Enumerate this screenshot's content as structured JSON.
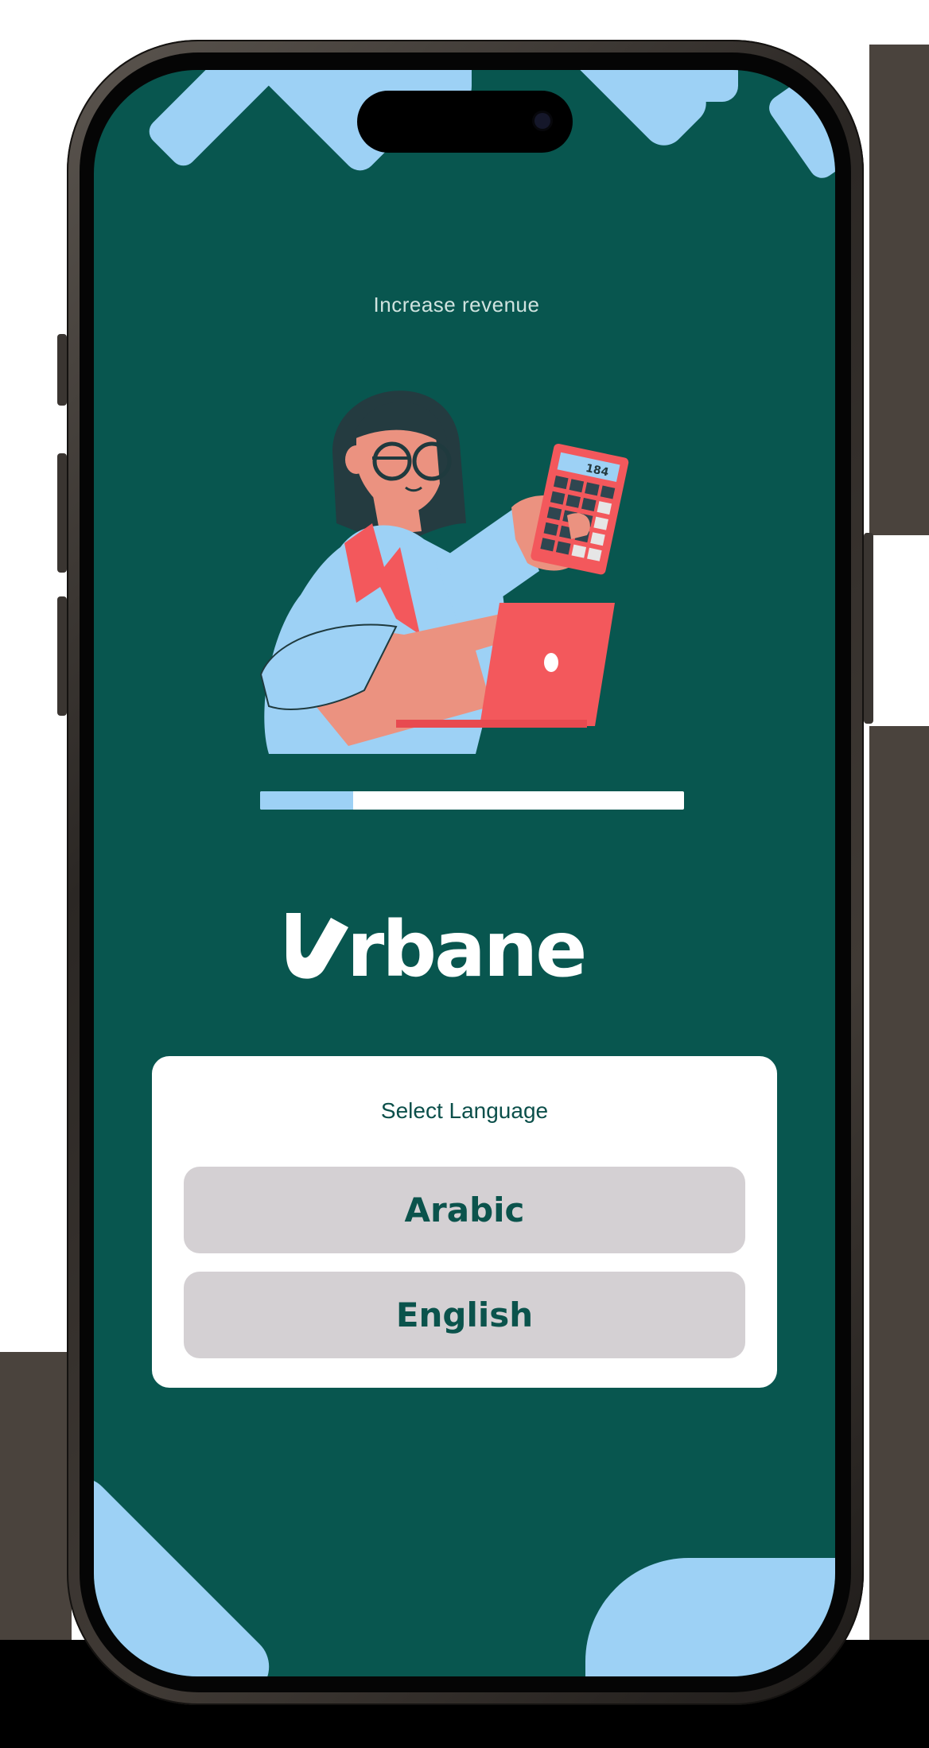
{
  "screen": {
    "tagline": "Increase revenue",
    "brand": {
      "name": "Urbane",
      "wordmark_rest": "rbane",
      "color": "#ffffff"
    },
    "progress": {
      "value": 0.22,
      "fill_color": "#9dd1f5",
      "track_color": "#ffffff"
    },
    "illustration": {
      "icon": "woman-with-calculator-and-laptop-illustration",
      "calculator_display": "184"
    },
    "language_selector": {
      "title": "Select Language",
      "options": [
        {
          "label": "Arabic"
        },
        {
          "label": "English"
        }
      ]
    }
  },
  "colors": {
    "background": "#08564f",
    "accent_light_blue": "#9dd1f5",
    "accent_red": "#f3585c",
    "button_bg": "#d4d0d3",
    "button_text": "#0b534c"
  }
}
